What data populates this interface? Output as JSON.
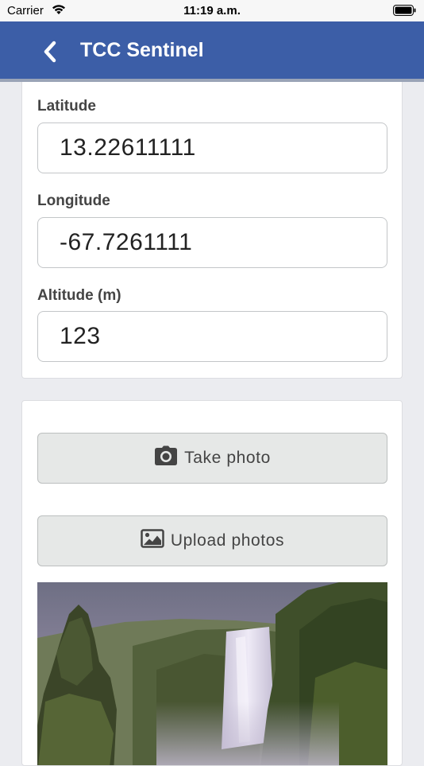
{
  "status_bar": {
    "carrier": "Carrier",
    "time": "11:19 a.m."
  },
  "nav": {
    "title": "TCC Sentinel",
    "back_icon": "chevron-left-icon"
  },
  "location": {
    "latitude": {
      "label": "Latitude",
      "value": "13.22611111"
    },
    "longitude": {
      "label": "Longitude",
      "value": "-67.7261111"
    },
    "altitude": {
      "label": "Altitude (m)",
      "value": "123"
    }
  },
  "photos": {
    "take_photo_label": "Take photo",
    "take_photo_icon": "camera-icon",
    "upload_label": "Upload photos",
    "upload_icon": "image-icon",
    "preview": "waterfall-photo"
  },
  "colors": {
    "nav_bar": "#3c5ea7",
    "background": "#ebecf0",
    "button": "#e6e8e7"
  }
}
